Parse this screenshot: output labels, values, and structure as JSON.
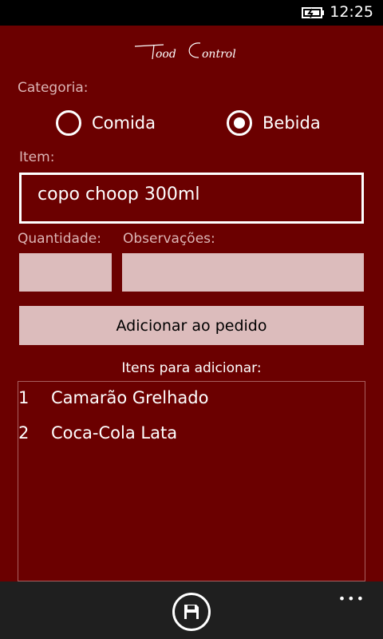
{
  "status_bar": {
    "time": "12:25",
    "battery_icon": "battery-charging-icon"
  },
  "logo": {
    "text": "FoodControl"
  },
  "categoria": {
    "label": "Categoria:",
    "options": [
      {
        "label": "Comida",
        "checked": false
      },
      {
        "label": "Bebida",
        "checked": true
      }
    ]
  },
  "item": {
    "label": "Item:",
    "value": "copo choop 300ml"
  },
  "quantidade": {
    "label": "Quantidade:",
    "value": ""
  },
  "observacoes": {
    "label": "Observações:",
    "value": ""
  },
  "add_button": {
    "label": "Adicionar ao pedido"
  },
  "list": {
    "title": "Itens para adicionar:",
    "items": [
      {
        "num": "1",
        "name": "Camarão Grelhado"
      },
      {
        "num": "2",
        "name": "Coca-Cola Lata"
      }
    ]
  },
  "app_bar": {
    "save_icon": "save-icon",
    "more_icon": "more-icon"
  }
}
